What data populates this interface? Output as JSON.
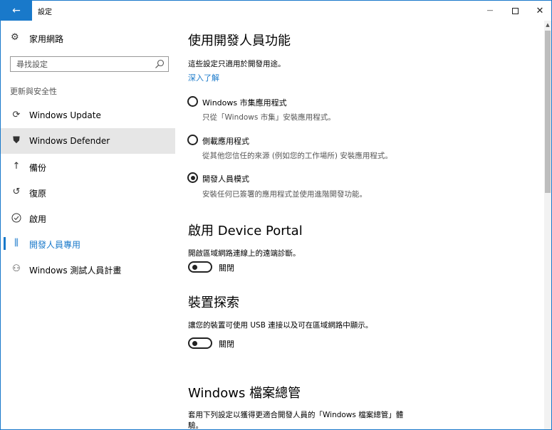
{
  "window": {
    "title": "設定",
    "back_glyph": "←",
    "minimize_glyph": "—",
    "close_glyph": "✕",
    "accent_color": "#1979ca"
  },
  "sidebar": {
    "home": {
      "label": "家用網路",
      "icon": "gear-icon"
    },
    "search": {
      "placeholder": "尋找設定",
      "icon": "search-icon"
    },
    "section_label": "更新與安全性",
    "items": [
      {
        "label": "Windows Update",
        "icon": "sync-icon",
        "glyph": "⟳"
      },
      {
        "label": "Windows Defender",
        "icon": "shield-icon",
        "glyph": "⛊",
        "selected": true
      },
      {
        "label": "備份",
        "icon": "backup-arrow-icon",
        "glyph": "↑"
      },
      {
        "label": "復原",
        "icon": "recovery-history-icon",
        "glyph": "↺"
      },
      {
        "label": "啟用",
        "icon": "check-circle-icon",
        "glyph": "✓"
      },
      {
        "label": "開發人員專用",
        "icon": "developer-tools-icon",
        "glyph": "⫼",
        "active": true
      },
      {
        "label": "Windows 測試人員計畫",
        "icon": "insider-person-icon",
        "glyph": "⚇"
      }
    ]
  },
  "main": {
    "dev_features": {
      "heading": "使用開發人員功能",
      "description": "這些設定只適用於開發用途。",
      "learn_more": "深入了解",
      "options": [
        {
          "label": "Windows 市集應用程式",
          "description": "只從「Windows 市集」安裝應用程式。",
          "checked": false
        },
        {
          "label": "側載應用程式",
          "description": "從其他您信任的來源 (例如您的工作場所) 安裝應用程式。",
          "checked": false
        },
        {
          "label": "開發人員模式",
          "description": "安裝任何已簽署的應用程式並使用進階開發功能。",
          "checked": true
        }
      ]
    },
    "device_portal": {
      "heading": "啟用 Device Portal",
      "description": "開啟區域網路連線上的遠端診斷。",
      "toggle_label": "關閉",
      "on": false
    },
    "device_discovery": {
      "heading": "裝置探索",
      "description": "讓您的裝置可使用 USB 連接以及可在區域網路中顯示。",
      "toggle_label": "關閉",
      "on": false
    },
    "file_explorer": {
      "heading": "Windows 檔案總管",
      "description_line1": "套用下列設定以獲得更適合開發人員的「Windows 檔案總管」體",
      "description_line2": "驗。"
    }
  }
}
